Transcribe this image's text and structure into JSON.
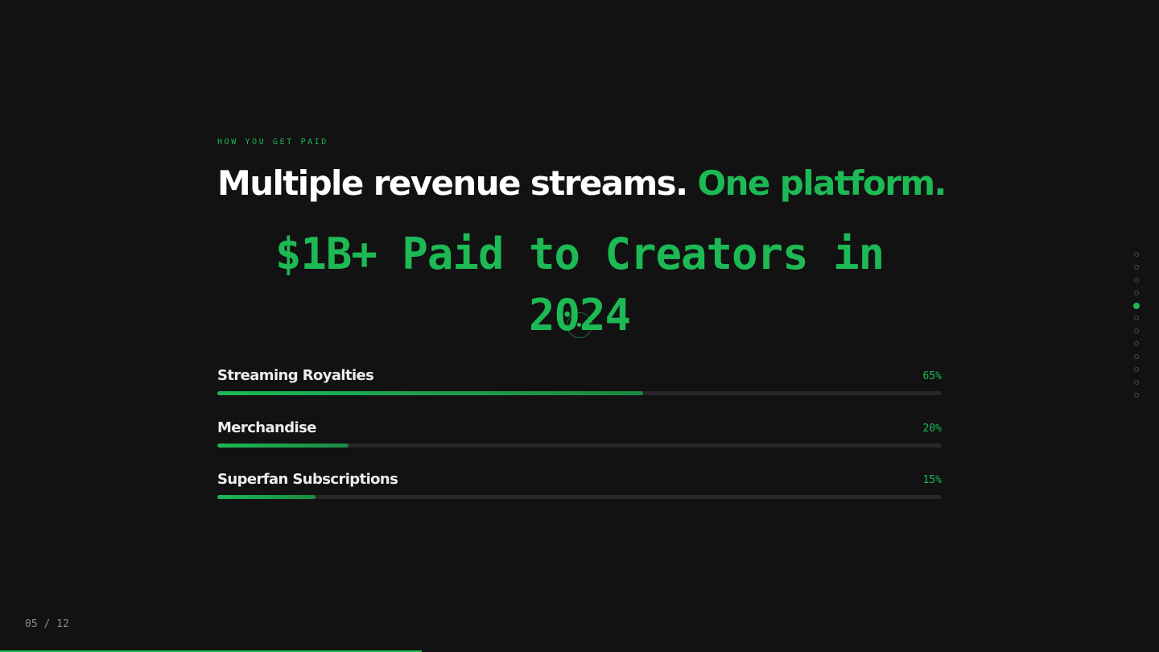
{
  "slide": {
    "eyebrow": "HOW YOU GET PAID",
    "headline_part1": "Multiple revenue streams.",
    "headline_part2": "One platform.",
    "stat_line1": "$1B+ Paid to Creators in",
    "stat_line2": "2024",
    "streams": [
      {
        "label": "Streaming Royalties",
        "percent_label": "65%",
        "fill_percent": 58.8
      },
      {
        "label": "Merchandise",
        "percent_label": "20%",
        "fill_percent": 18.1
      },
      {
        "label": "Superfan Subscriptions",
        "percent_label": "15%",
        "fill_percent": 13.6
      }
    ]
  },
  "navigation": {
    "dots_total": 12,
    "active_index": 4,
    "page_counter": "05 / 12",
    "progress_fraction": 0.364
  },
  "colors": {
    "background": "#121212",
    "accent": "#1db954",
    "track": "#272727"
  }
}
